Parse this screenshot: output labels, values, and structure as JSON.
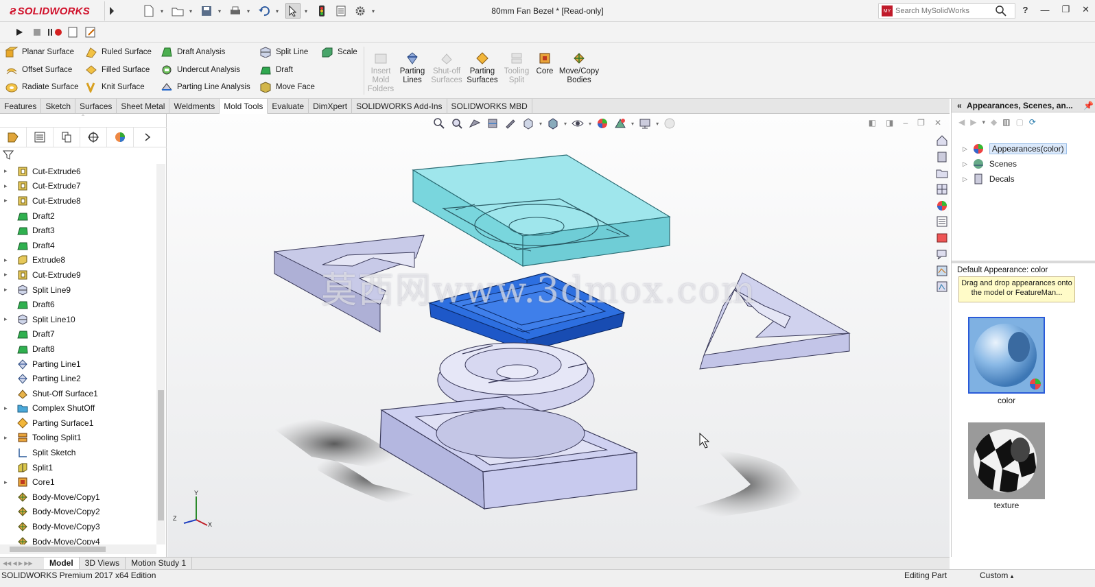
{
  "app": {
    "brand": "SOLIDWORKS",
    "document_title": "80mm Fan Bezel * [Read-only]",
    "search_placeholder": "Search MySolidWorks",
    "help": "?"
  },
  "ribbon": {
    "col1": [
      "Planar Surface",
      "Offset Surface",
      "Radiate Surface"
    ],
    "col2": [
      "Ruled Surface",
      "Filled Surface",
      "Knit Surface"
    ],
    "col3": [
      "Draft Analysis",
      "Undercut Analysis",
      "Parting Line Analysis"
    ],
    "col4": [
      "Split Line",
      "Draft",
      "Move Face"
    ],
    "scale": "Scale",
    "big": [
      {
        "label": "Insert\nMold\nFolders",
        "disabled": true
      },
      {
        "label": "Parting\nLines",
        "disabled": false
      },
      {
        "label": "Shut-off\nSurfaces",
        "disabled": true
      },
      {
        "label": "Parting\nSurfaces",
        "disabled": false
      },
      {
        "label": "Tooling\nSplit",
        "disabled": true
      },
      {
        "label": "Core",
        "disabled": false
      },
      {
        "label": "Move/Copy\nBodies",
        "disabled": false
      }
    ]
  },
  "tabs": [
    "Features",
    "Sketch",
    "Surfaces",
    "Sheet Metal",
    "Weldments",
    "Mold Tools",
    "Evaluate",
    "DimXpert",
    "SOLIDWORKS Add-Ins",
    "SOLIDWORKS MBD"
  ],
  "active_tab": "Mold Tools",
  "tree": [
    {
      "label": "Cut-Extrude6",
      "exp": true,
      "icon": "cut-extrude-icon"
    },
    {
      "label": "Cut-Extrude7",
      "exp": true,
      "icon": "cut-extrude-icon"
    },
    {
      "label": "Cut-Extrude8",
      "exp": true,
      "icon": "cut-extrude-icon"
    },
    {
      "label": "Draft2",
      "exp": false,
      "icon": "draft-icon"
    },
    {
      "label": "Draft3",
      "exp": false,
      "icon": "draft-icon"
    },
    {
      "label": "Draft4",
      "exp": false,
      "icon": "draft-icon"
    },
    {
      "label": "Extrude8",
      "exp": true,
      "icon": "extrude-icon"
    },
    {
      "label": "Cut-Extrude9",
      "exp": true,
      "icon": "cut-extrude-icon"
    },
    {
      "label": "Split Line9",
      "exp": true,
      "icon": "split-line-icon"
    },
    {
      "label": "Draft6",
      "exp": false,
      "icon": "draft-icon"
    },
    {
      "label": "Split Line10",
      "exp": true,
      "icon": "split-line-icon"
    },
    {
      "label": "Draft7",
      "exp": false,
      "icon": "draft-icon"
    },
    {
      "label": "Draft8",
      "exp": false,
      "icon": "draft-icon"
    },
    {
      "label": "Parting Line1",
      "exp": false,
      "icon": "parting-line-icon"
    },
    {
      "label": "Parting Line2",
      "exp": false,
      "icon": "parting-line-icon"
    },
    {
      "label": "Shut-Off Surface1",
      "exp": false,
      "icon": "shutoff-surface-icon"
    },
    {
      "label": "Complex ShutOff",
      "exp": true,
      "icon": "folder-icon"
    },
    {
      "label": "Parting Surface1",
      "exp": false,
      "icon": "parting-surface-icon"
    },
    {
      "label": "Tooling Split1",
      "exp": true,
      "icon": "tooling-split-icon"
    },
    {
      "label": "Split Sketch",
      "exp": false,
      "icon": "sketch-icon"
    },
    {
      "label": "Split1",
      "exp": false,
      "icon": "split-icon"
    },
    {
      "label": "Core1",
      "exp": true,
      "icon": "core-icon"
    },
    {
      "label": "Body-Move/Copy1",
      "exp": false,
      "icon": "move-copy-icon"
    },
    {
      "label": "Body-Move/Copy2",
      "exp": false,
      "icon": "move-copy-icon"
    },
    {
      "label": "Body-Move/Copy3",
      "exp": false,
      "icon": "move-copy-icon"
    },
    {
      "label": "Body-Move/Copy4",
      "exp": false,
      "icon": "move-copy-icon"
    }
  ],
  "viewport": {
    "watermark": "莫西网www.3dmox.com",
    "axis_x": "X",
    "axis_y": "Y",
    "axis_z": "Z"
  },
  "taskpane": {
    "title": "Appearances, Scenes, an...",
    "tree": [
      "Appearances(color)",
      "Scenes",
      "Decals"
    ],
    "default_appearance": "Default Appearance: color",
    "tooltip": "Drag and drop appearances onto the model or FeatureMan...",
    "swatches": [
      "color",
      "texture"
    ]
  },
  "bottom_tabs": [
    "Model",
    "3D Views",
    "Motion Study 1"
  ],
  "status": {
    "edition": "SOLIDWORKS Premium 2017 x64 Edition",
    "mode": "Editing Part",
    "units": "Custom"
  },
  "colors": {
    "brand_red": "#d0102a",
    "cavity_cyan": "#7fdde6",
    "insert_blue": "#1f63d6",
    "part_lavender": "#c9cbee"
  }
}
